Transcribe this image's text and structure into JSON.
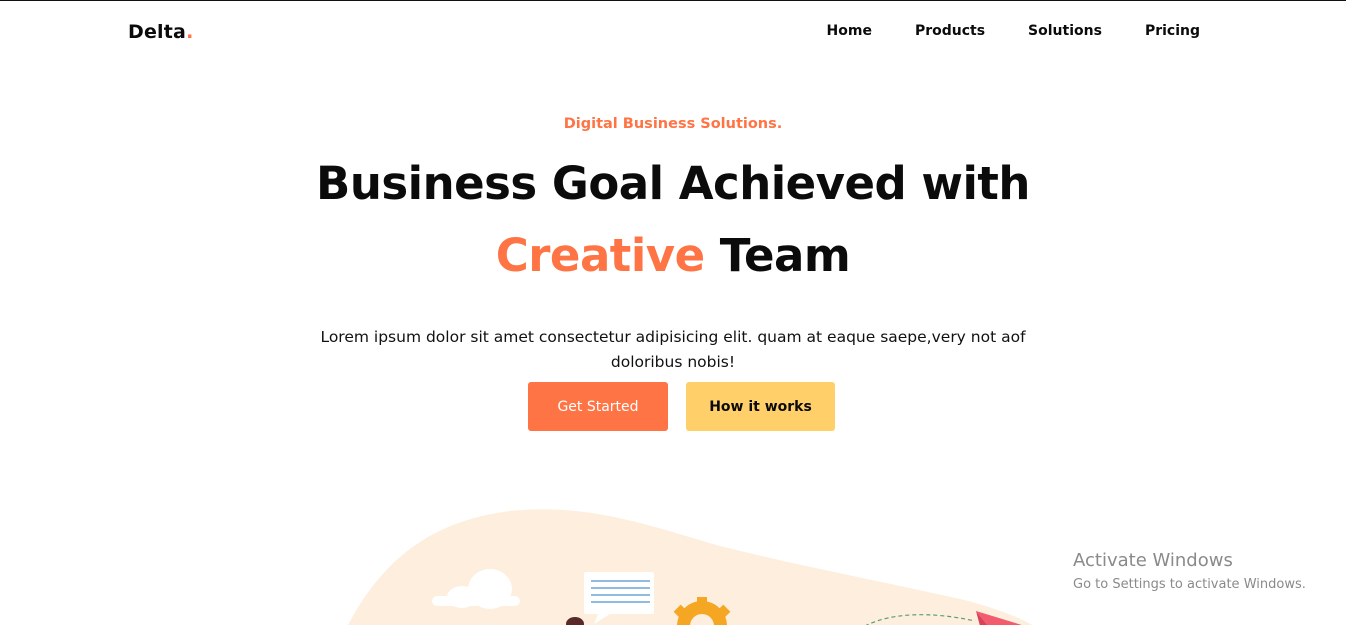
{
  "header": {
    "logo_text": "Delta",
    "logo_dot": ".",
    "nav": [
      {
        "label": "Home"
      },
      {
        "label": "Products"
      },
      {
        "label": "Solutions"
      },
      {
        "label": "Pricing"
      }
    ]
  },
  "hero": {
    "eyebrow": "Digital Business Solutions.",
    "headline_line1": "Business Goal Achieved with",
    "headline_accent": "Creative",
    "headline_rest": " Team",
    "description": "Lorem ipsum dolor sit amet consectetur adipisicing elit. quam at eaque saepe,very not aof doloribus nobis!",
    "primary_button": "Get Started",
    "secondary_button": "How it works"
  },
  "illustration": {
    "icons": [
      "cloud-icon",
      "chat-bubble-icon",
      "gear-icon",
      "paper-plane-icon",
      "person-icon"
    ]
  },
  "watermark": {
    "title": "Activate Windows",
    "subtitle": "Go to Settings to activate Windows."
  },
  "colors": {
    "accent": "#ff7445",
    "secondary": "#ffd06a",
    "blob": "#fdeedd",
    "text": "#0b0b0b"
  }
}
